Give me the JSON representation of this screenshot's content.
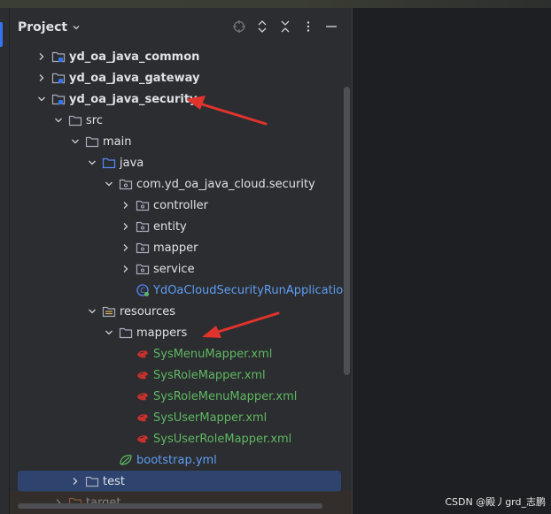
{
  "panel": {
    "title": "Project"
  },
  "toolbar": {
    "locate": "crosshair-icon",
    "expand": "expand-all-icon",
    "collapse": "collapse-all-icon",
    "options": "more-vertical-icon",
    "hide": "minimize-icon"
  },
  "tree": [
    {
      "label": "yd_oa_java_common",
      "depth": 1,
      "arrow": "right",
      "icon": "module",
      "style": "bold"
    },
    {
      "label": "yd_oa_java_gateway",
      "depth": 1,
      "arrow": "right",
      "icon": "module",
      "style": "bold"
    },
    {
      "label": "yd_oa_java_security",
      "depth": 1,
      "arrow": "down",
      "icon": "module",
      "style": "bold"
    },
    {
      "label": "src",
      "depth": 2,
      "arrow": "down",
      "icon": "folder",
      "style": "plain"
    },
    {
      "label": "main",
      "depth": 3,
      "arrow": "down",
      "icon": "folder",
      "style": "plain"
    },
    {
      "label": "java",
      "depth": 4,
      "arrow": "down",
      "icon": "source-folder",
      "style": "plain"
    },
    {
      "label": "com.yd_oa_java_cloud.security",
      "depth": 5,
      "arrow": "down",
      "icon": "package",
      "style": "plain"
    },
    {
      "label": "controller",
      "depth": 6,
      "arrow": "right",
      "icon": "package",
      "style": "plain"
    },
    {
      "label": "entity",
      "depth": 6,
      "arrow": "right",
      "icon": "package",
      "style": "plain"
    },
    {
      "label": "mapper",
      "depth": 6,
      "arrow": "right",
      "icon": "package",
      "style": "plain"
    },
    {
      "label": "service",
      "depth": 6,
      "arrow": "right",
      "icon": "package",
      "style": "plain"
    },
    {
      "label": "YdOaCloudSecurityRunApplication",
      "depth": 6,
      "arrow": "none",
      "icon": "spring-class",
      "style": "blue"
    },
    {
      "label": "resources",
      "depth": 4,
      "arrow": "down",
      "icon": "resources-folder",
      "style": "plain"
    },
    {
      "label": "mappers",
      "depth": 5,
      "arrow": "down",
      "icon": "folder",
      "style": "plain"
    },
    {
      "label": "SysMenuMapper.xml",
      "depth": 6,
      "arrow": "none",
      "icon": "mybatis",
      "style": "green"
    },
    {
      "label": "SysRoleMapper.xml",
      "depth": 6,
      "arrow": "none",
      "icon": "mybatis",
      "style": "green"
    },
    {
      "label": "SysRoleMenuMapper.xml",
      "depth": 6,
      "arrow": "none",
      "icon": "mybatis",
      "style": "green"
    },
    {
      "label": "SysUserMapper.xml",
      "depth": 6,
      "arrow": "none",
      "icon": "mybatis",
      "style": "green"
    },
    {
      "label": "SysUserRoleMapper.xml",
      "depth": 6,
      "arrow": "none",
      "icon": "mybatis",
      "style": "green"
    },
    {
      "label": "bootstrap.yml",
      "depth": 5,
      "arrow": "none",
      "icon": "spring-config",
      "style": "blue"
    },
    {
      "label": "test",
      "depth": 3,
      "arrow": "right",
      "icon": "folder",
      "style": "plain",
      "selected": true
    },
    {
      "label": "target",
      "depth": 2,
      "arrow": "right",
      "icon": "excluded-folder",
      "style": "plain"
    }
  ],
  "watermark": "CSDN @殿丿grd_志鹏",
  "colors": {
    "background": "#2b2d30",
    "selection": "#2e436e",
    "annotation_arrow": "#e0332d",
    "xml_text": "#5fb862",
    "spring_text": "#5e9ef5"
  }
}
